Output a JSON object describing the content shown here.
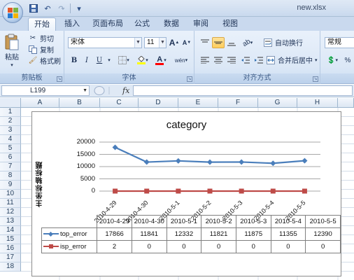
{
  "window": {
    "title": "new.xlsx",
    "qat_icons": [
      "save-icon",
      "undo-icon",
      "redo-icon",
      "customize-icon"
    ]
  },
  "tabs": [
    "开始",
    "插入",
    "页面布局",
    "公式",
    "数据",
    "审阅",
    "视图"
  ],
  "ribbon": {
    "clipboard": {
      "paste_label": "粘贴",
      "cut_label": "剪切",
      "copy_label": "复制",
      "format_painter_label": "格式刷",
      "group_label": "剪贴板"
    },
    "font": {
      "font_name": "宋体",
      "font_size": "11",
      "grow_label": "A",
      "shrink_label": "A",
      "bold_label": "B",
      "italic_label": "I",
      "underline_label": "U",
      "phonetic_label": "wén",
      "group_label": "字体"
    },
    "alignment": {
      "wrap_label": "自动换行",
      "merge_label": "合并后居中",
      "group_label": "对齐方式"
    },
    "number": {
      "format": "常规",
      "percent_label": "%"
    },
    "colors": {
      "fill": "#ffff00",
      "font": "#ff0000"
    }
  },
  "formula_bar": {
    "name_box": "L199",
    "fx_label": "fx",
    "formula": ""
  },
  "sheet": {
    "columns": [
      "A",
      "B",
      "C",
      "D",
      "E",
      "F",
      "G",
      "H"
    ],
    "rows": [
      "1",
      "2",
      "3",
      "4",
      "5",
      "6",
      "7",
      "8",
      "9",
      "10",
      "11",
      "12",
      "13",
      "14",
      "15",
      "16",
      "17",
      "18"
    ]
  },
  "chart_data": {
    "type": "line",
    "title": "category",
    "ylabel": "主坐标轴标题",
    "xlabel": "",
    "categories": [
      "2010-4-29",
      "2010-4-30",
      "2010-5-1",
      "2010-5-2",
      "2010-5-3",
      "2010-5-4",
      "2010-5-5"
    ],
    "yticks": [
      "20000",
      "15000",
      "10000",
      "5000",
      "0"
    ],
    "ylim": [
      0,
      20000
    ],
    "grid": true,
    "legend": "data table with legend keys",
    "series": [
      {
        "name": "top_error",
        "values": [
          17866,
          11841,
          12332,
          11821,
          11875,
          11355,
          12390
        ],
        "color": "#4a7ebb",
        "marker": "diamond"
      },
      {
        "name": "isp_error",
        "values": [
          2,
          0,
          0,
          0,
          0,
          0,
          0
        ],
        "color": "#be4b48",
        "marker": "square"
      }
    ]
  }
}
